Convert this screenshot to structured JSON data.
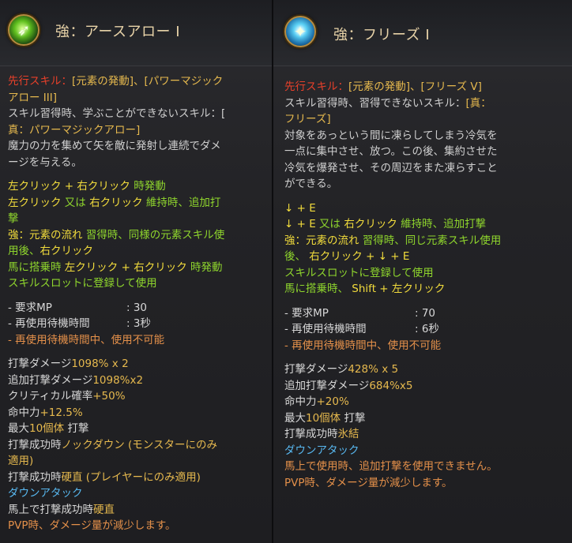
{
  "left": {
    "title": "強：アースアロー I",
    "prereq": {
      "label": "先行スキル：",
      "line1_value": "[元素の発動]、[パワーマジック",
      "line2_value": "アロー III]"
    },
    "unlearn_1": "スキル習得時、学ぶことができないスキル：[",
    "unlearn_2": "真：パワーマジックアロー]",
    "desc_1": "魔力の力を集めて矢を敵に発射し連続でダメ",
    "desc_2": "ージを与える。",
    "cmd1_a": "左クリック + 右クリック",
    "cmd1_b": " 時発動",
    "cmd2_a": "左クリック",
    "cmd2_b": " 又は ",
    "cmd2_c": "右クリック",
    "cmd2_d": " 維持時、追加打",
    "cmd2_e": "撃",
    "cmd3_a": "強：元素の流れ",
    "cmd3_b": " 習得時、同様の元素スキル使",
    "cmd3_c": "用後、",
    "cmd3_d": "右クリック",
    "cmd4_a": "馬に搭乗時 ",
    "cmd4_b": "左クリック + 右クリック",
    "cmd4_c": " 時発動",
    "cmd5": "スキルスロットに登録して使用",
    "mp_label": "- 要求MP",
    "mp_value": ": 30",
    "cd_label": "- 再使用待機時間",
    "cd_value": ": 3秒",
    "cd_note": "- 再使用待機時間中、使用不可能",
    "dmg1_a": "打撃ダメージ",
    "dmg1_b": "1098% x 2",
    "dmg2_a": "追加打撃ダメージ",
    "dmg2_b": "1098%x2",
    "crit_a": "クリティカル確率",
    "crit_b": "+50%",
    "acc_a": "命中力",
    "acc_b": "+12.5%",
    "max_a": "最大",
    "max_b": "10個体",
    "max_c": " 打撃",
    "ko_a": "打撃成功時",
    "ko_b": "ノックダウン (モンスターにのみ",
    "ko_c": "適用)",
    "stiff_a": "打撃成功時",
    "stiff_b": "硬直 (プレイヤーにのみ適用)",
    "down": "ダウンアタック",
    "mount_a": "馬上で打撃成功時",
    "mount_b": "硬直",
    "pvp": "PVP時、ダメージ量が減少します。"
  },
  "right": {
    "title": "強：フリーズ I",
    "prereq_label": "先行スキル：",
    "prereq_value": "[元素の発動]、[フリーズ V]",
    "unlearn_1a": "スキル習得時、習得できないスキル：",
    "unlearn_1b": "[真：",
    "unlearn_2": "フリーズ]",
    "desc_1": "対象をあっという間に凍らしてしまう冷気を",
    "desc_2": "一点に集中させ、放つ。この後、集約させた",
    "desc_3": "冷気を爆発させ、その周辺をまた凍らすこと",
    "desc_4": "ができる。",
    "cmd1": "↓ + E",
    "cmd2_a": "↓ + E",
    "cmd2_b": " 又は ",
    "cmd2_c": "右クリック",
    "cmd2_d": " 維持時、追加打撃",
    "cmd3_a": "強：元素の流れ",
    "cmd3_b": " 習得時、同じ元素スキル使用",
    "cmd3_c": "後、 ",
    "cmd3_d": "右クリック + ↓ + E",
    "cmd4": "スキルスロットに登録して使用",
    "cmd5_a": "馬に搭乗時、 ",
    "cmd5_b": "Shift + 左クリック",
    "mp_label": "- 要求MP",
    "mp_value": ": 70",
    "cd_label": "- 再使用待機時間",
    "cd_value": ": 6秒",
    "cd_note": "- 再使用待機時間中、使用不可能",
    "dmg1_a": "打撃ダメージ",
    "dmg1_b": "428% x 5",
    "dmg2_a": "追加打撃ダメージ",
    "dmg2_b": "684%x5",
    "acc_a": "命中力",
    "acc_b": "+20%",
    "max_a": "最大",
    "max_b": "10個体",
    "max_c": " 打撃",
    "freeze_a": "打撃成功時",
    "freeze_b": "氷結",
    "down": "ダウンアタック",
    "mount_note": "馬上で使用時、追加打撃を使用できません。",
    "pvp": "PVP時、ダメージ量が減少します。"
  }
}
